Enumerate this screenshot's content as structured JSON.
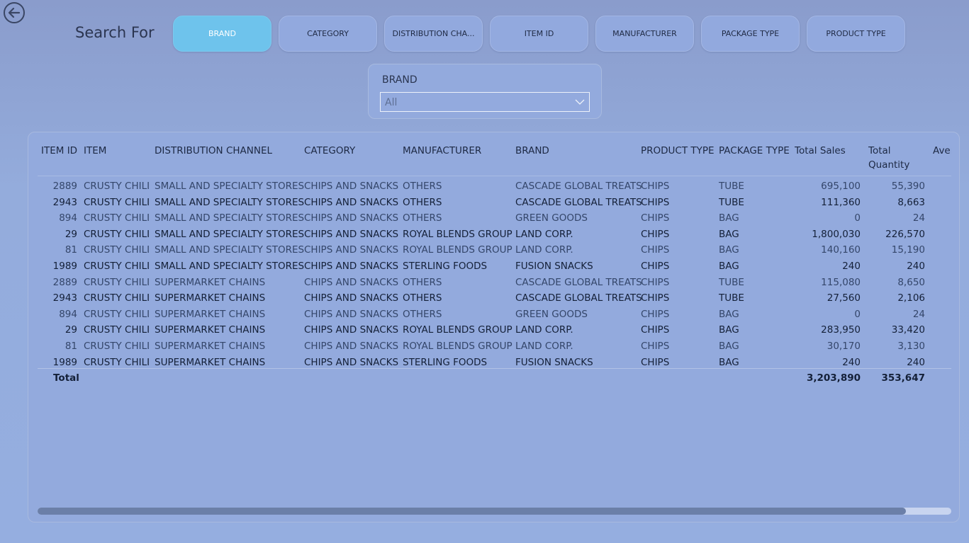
{
  "header": {
    "search_label": "Search For",
    "filters": [
      {
        "label": "BRAND",
        "active": true
      },
      {
        "label": "CATEGORY",
        "active": false
      },
      {
        "label": "DISTRIBUTION CHA...",
        "active": false
      },
      {
        "label": "ITEM ID",
        "active": false
      },
      {
        "label": "MANUFACTURER",
        "active": false
      },
      {
        "label": "PACKAGE TYPE",
        "active": false
      },
      {
        "label": "PRODUCT TYPE",
        "active": false
      }
    ]
  },
  "slicer": {
    "title": "BRAND",
    "value": "All"
  },
  "table": {
    "columns": [
      "ITEM ID",
      "ITEM",
      "DISTRIBUTION CHANNEL",
      "CATEGORY",
      "MANUFACTURER",
      "BRAND",
      "PRODUCT TYPE",
      "PACKAGE TYPE",
      "Total Sales",
      "Total",
      "Quantity",
      "Aver"
    ],
    "rows": [
      {
        "item_id": "2889",
        "item": "CRUSTY CHILI",
        "channel": "SMALL AND SPECIALTY STORES",
        "category": "CHIPS AND SNACKS",
        "manufacturer": "OTHERS",
        "brand": "CASCADE GLOBAL TREATS",
        "product_type": "CHIPS",
        "package_type": "TUBE",
        "total_sales": "695,100",
        "total_quantity": "55,390",
        "style": "dim"
      },
      {
        "item_id": "2943",
        "item": "CRUSTY CHILI",
        "channel": "SMALL AND SPECIALTY STORES",
        "category": "CHIPS AND SNACKS",
        "manufacturer": "OTHERS",
        "brand": "CASCADE GLOBAL TREATS",
        "product_type": "CHIPS",
        "package_type": "TUBE",
        "total_sales": "111,360",
        "total_quantity": "8,663",
        "style": "bold"
      },
      {
        "item_id": "894",
        "item": "CRUSTY CHILI",
        "channel": "SMALL AND SPECIALTY STORES",
        "category": "CHIPS AND SNACKS",
        "manufacturer": "OTHERS",
        "brand": "GREEN GOODS",
        "product_type": "CHIPS",
        "package_type": "BAG",
        "total_sales": "0",
        "total_quantity": "24",
        "style": "dim"
      },
      {
        "item_id": "29",
        "item": "CRUSTY CHILI",
        "channel": "SMALL AND SPECIALTY STORES",
        "category": "CHIPS AND SNACKS",
        "manufacturer": "ROYAL BLENDS GROUP",
        "brand": "LAND CORP.",
        "product_type": "CHIPS",
        "package_type": "BAG",
        "total_sales": "1,800,030",
        "total_quantity": "226,570",
        "style": "bold"
      },
      {
        "item_id": "81",
        "item": "CRUSTY CHILI",
        "channel": "SMALL AND SPECIALTY STORES",
        "category": "CHIPS AND SNACKS",
        "manufacturer": "ROYAL BLENDS GROUP",
        "brand": "LAND CORP.",
        "product_type": "CHIPS",
        "package_type": "BAG",
        "total_sales": "140,160",
        "total_quantity": "15,190",
        "style": "dim"
      },
      {
        "item_id": "1989",
        "item": "CRUSTY CHILI",
        "channel": "SMALL AND SPECIALTY STORES",
        "category": "CHIPS AND SNACKS",
        "manufacturer": "STERLING FOODS",
        "brand": "FUSION SNACKS",
        "product_type": "CHIPS",
        "package_type": "BAG",
        "total_sales": "240",
        "total_quantity": "240",
        "style": "bold"
      },
      {
        "item_id": "2889",
        "item": "CRUSTY CHILI",
        "channel": "SUPERMARKET CHAINS",
        "category": "CHIPS AND SNACKS",
        "manufacturer": "OTHERS",
        "brand": "CASCADE GLOBAL TREATS",
        "product_type": "CHIPS",
        "package_type": "TUBE",
        "total_sales": "115,080",
        "total_quantity": "8,650",
        "style": "dim"
      },
      {
        "item_id": "2943",
        "item": "CRUSTY CHILI",
        "channel": "SUPERMARKET CHAINS",
        "category": "CHIPS AND SNACKS",
        "manufacturer": "OTHERS",
        "brand": "CASCADE GLOBAL TREATS",
        "product_type": "CHIPS",
        "package_type": "TUBE",
        "total_sales": "27,560",
        "total_quantity": "2,106",
        "style": "bold"
      },
      {
        "item_id": "894",
        "item": "CRUSTY CHILI",
        "channel": "SUPERMARKET CHAINS",
        "category": "CHIPS AND SNACKS",
        "manufacturer": "OTHERS",
        "brand": "GREEN GOODS",
        "product_type": "CHIPS",
        "package_type": "BAG",
        "total_sales": "0",
        "total_quantity": "24",
        "style": "dim"
      },
      {
        "item_id": "29",
        "item": "CRUSTY CHILI",
        "channel": "SUPERMARKET CHAINS",
        "category": "CHIPS AND SNACKS",
        "manufacturer": "ROYAL BLENDS GROUP",
        "brand": "LAND CORP.",
        "product_type": "CHIPS",
        "package_type": "BAG",
        "total_sales": "283,950",
        "total_quantity": "33,420",
        "style": "bold"
      },
      {
        "item_id": "81",
        "item": "CRUSTY CHILI",
        "channel": "SUPERMARKET CHAINS",
        "category": "CHIPS AND SNACKS",
        "manufacturer": "ROYAL BLENDS GROUP",
        "brand": "LAND CORP.",
        "product_type": "CHIPS",
        "package_type": "BAG",
        "total_sales": "30,170",
        "total_quantity": "3,130",
        "style": "dim"
      },
      {
        "item_id": "1989",
        "item": "CRUSTY CHILI",
        "channel": "SUPERMARKET CHAINS",
        "category": "CHIPS AND SNACKS",
        "manufacturer": "STERLING FOODS",
        "brand": "FUSION SNACKS",
        "product_type": "CHIPS",
        "package_type": "BAG",
        "total_sales": "240",
        "total_quantity": "240",
        "style": "bold"
      }
    ],
    "total": {
      "label": "Total",
      "total_sales": "3,203,890",
      "total_quantity": "353,647"
    }
  },
  "scrollbar": {
    "visible_fraction": 0.95
  },
  "colors": {
    "active_filter": "#6ec3ec",
    "background": "#94acdc"
  }
}
